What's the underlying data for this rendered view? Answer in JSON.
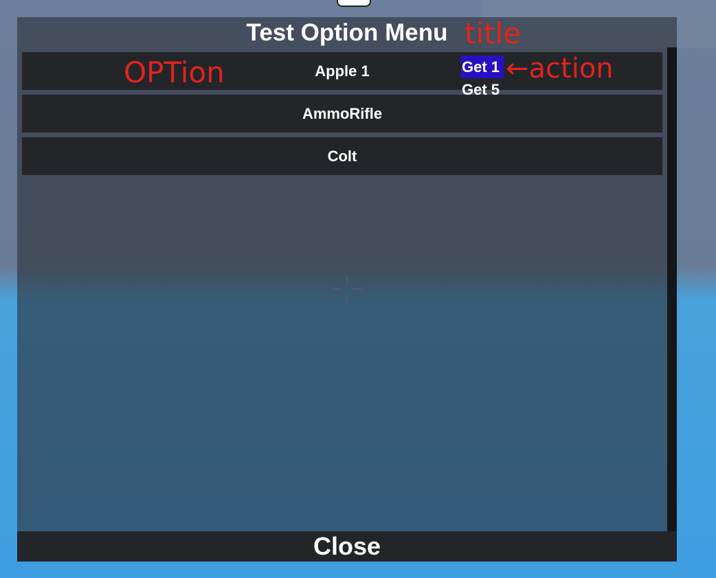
{
  "menu": {
    "title": "Test Option Menu",
    "options": [
      {
        "label": "Apple 1"
      },
      {
        "label": "AmmoRifle"
      },
      {
        "label": "Colt"
      }
    ],
    "actions": [
      {
        "label": "Get 1",
        "selected": true
      },
      {
        "label": "Get 5",
        "selected": false
      }
    ],
    "close_label": "Close"
  },
  "annotations": {
    "option": "OPTion",
    "title": "title",
    "action": "action"
  },
  "colors": {
    "panel": "#232529",
    "selected_action": "#2a10c4",
    "annotation": "#e0241f",
    "text": "#ffffff"
  }
}
